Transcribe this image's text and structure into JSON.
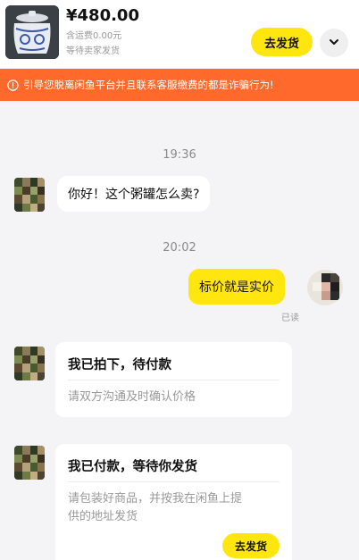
{
  "product": {
    "price": "¥480.00",
    "shipping": "含运费0.00元",
    "status": "等待卖家发货",
    "ship_button": "去发货"
  },
  "warning": {
    "text": "引导您脱离闲鱼平台并且联系客服缴费的都是诈骗行为!"
  },
  "chat": {
    "time_1": "19:36",
    "msg_1": "你好！这个粥罐怎么卖?",
    "time_2": "20:02",
    "msg_2": "标价就是实价",
    "read_status": "已读",
    "card_1": {
      "title": "我已拍下，待付款",
      "desc": "请双方沟通及时确认价格"
    },
    "card_2": {
      "title": "我已付款，等待你发货",
      "desc_line1": "请包装好商品，并按我在闲鱼上提",
      "desc_line2": "供的地址发货",
      "button": "去发货"
    }
  },
  "colors": {
    "accent_yellow": "#ffe60f",
    "warning_orange": "#ff6a2c"
  },
  "icons": {
    "expand": "chevron-down-icon",
    "warning": "alert-circle-icon"
  }
}
